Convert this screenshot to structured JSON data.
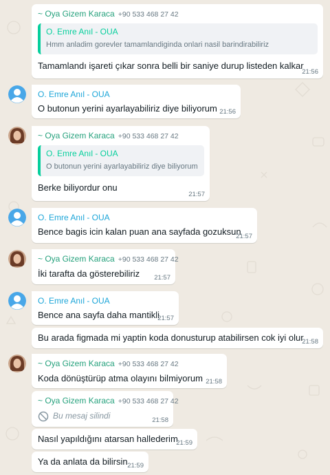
{
  "colors": {
    "wallpaper": "#efeae2",
    "bubble": "#ffffff",
    "name_teal": "#06cf9c",
    "name_green": "#25a17c",
    "name_blue": "#1ba5d8",
    "meta_gray": "#667781"
  },
  "messages": [
    {
      "sender": "~ Oya Gizem Karaca",
      "phone": "+90 533 468 27 42",
      "quote_sender": "O. Emre Anıl - OUA",
      "quote_text": "Hmm anladim gorevler tamamlandiginda onlari nasil barindirabiliriz",
      "text": "Tamamlandı işareti çıkar sonra belli bir saniye durup listeden kalkar",
      "time": "21:56"
    },
    {
      "sender": "O. Emre Anıl - OUA",
      "text": "O butonun yerini ayarlayabiliriz diye biliyorum",
      "time": "21:56"
    },
    {
      "sender": "~ Oya Gizem Karaca",
      "phone": "+90 533 468 27 42",
      "quote_sender": "O. Emre Anıl - OUA",
      "quote_text": "O butonun yerini ayarlayabiliriz diye biliyorum",
      "text": "Berke biliyordur onu",
      "time": "21:57"
    },
    {
      "sender": "O. Emre Anıl - OUA",
      "text": "Bence bagis icin kalan puan ana sayfada gozuksun",
      "time": "21:57"
    },
    {
      "sender": "~ Oya Gizem Karaca",
      "phone": "+90 533 468 27 42",
      "text": "İki tarafta da gösterebiliriz",
      "time": "21:57"
    },
    {
      "sender": "O. Emre Anıl - OUA",
      "text": "Bence ana sayfa daha mantikli",
      "time": "21:57"
    },
    {
      "text": "Bu arada figmada mi yaptin koda donusturup atabilirsen cok iyi olur",
      "time": "21:58"
    },
    {
      "sender": "~ Oya Gizem Karaca",
      "phone": "+90 533 468 27 42",
      "text": "Koda dönüştürüp atma olayını bilmiyorum",
      "time": "21:58"
    },
    {
      "sender": "~ Oya Gizem Karaca",
      "phone": "+90 533 468 27 42",
      "deleted_text": "Bu mesaj silindi",
      "time": "21:58"
    },
    {
      "text": "Nasıl yapıldığını atarsan hallederim",
      "time": "21:59"
    },
    {
      "text": "Ya da anlata da bilirsin",
      "time": "21:59"
    }
  ]
}
